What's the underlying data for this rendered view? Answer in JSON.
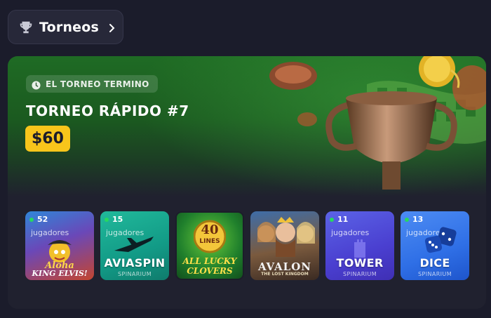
{
  "header": {
    "title": "Torneos"
  },
  "tournament": {
    "status": "EL TORNEO TERMINO",
    "title": "TORNEO RÁPIDO #7",
    "prize": "$60"
  },
  "games": [
    {
      "players": "52",
      "players_label": "jugadores",
      "art_text": [
        "Aloha",
        "KING ELVIS!"
      ]
    },
    {
      "players": "15",
      "players_label": "jugadores",
      "name": "AVIASPIN",
      "brand": "SPINARIUM"
    },
    {
      "art_text": [
        "40",
        "LINES",
        "ALL LUCKY",
        "CLOVERS"
      ]
    },
    {
      "art_text": [
        "AVALON",
        "THE LOST KINGDOM"
      ]
    },
    {
      "players": "11",
      "players_label": "jugadores",
      "name": "TOWER",
      "brand": "SPINARIUM"
    },
    {
      "players": "13",
      "players_label": "jugadores",
      "name": "DICE",
      "brand": "SPINARIUM"
    }
  ],
  "colors": {
    "background": "#1b1c2b",
    "accent_prize": "#f8c51b",
    "online_dot": "#27d95f"
  }
}
